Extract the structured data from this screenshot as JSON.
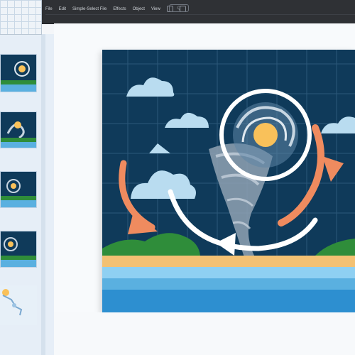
{
  "menu": {
    "items": [
      "File",
      "Edit",
      "Simple-Select File",
      "Effects",
      "Object",
      "View"
    ],
    "search_text": "Q"
  },
  "thumbnails": [
    {
      "name": "slide-1",
      "selected": false
    },
    {
      "name": "slide-2",
      "selected": false
    },
    {
      "name": "slide-3",
      "selected": false
    },
    {
      "name": "slide-4",
      "selected": false
    },
    {
      "name": "slide-5",
      "selected": false
    }
  ],
  "colors": {
    "sky": "#0f3a5a",
    "ocean": "#1e88c8",
    "sand": "#f3c173",
    "sun": "#f9c15a",
    "arrow_orange": "#ef8b5f",
    "cloud": "#b9dcf0",
    "land": "#2f8d3a"
  }
}
